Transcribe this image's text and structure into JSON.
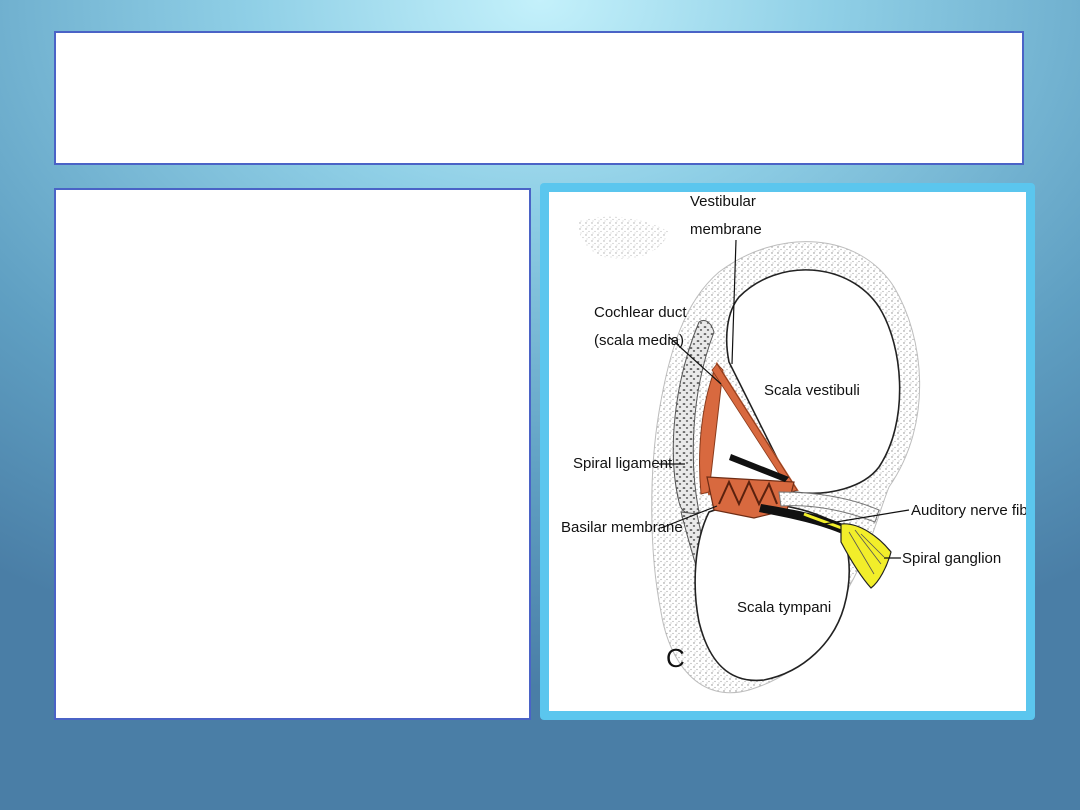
{
  "slide": {
    "title": "",
    "body": ""
  },
  "figure": {
    "labels": {
      "vestibular_membrane_1": "Vestibular",
      "vestibular_membrane_2": "membrane",
      "cochlear_duct_1": "Cochlear duct",
      "cochlear_duct_2": "(scala media)",
      "scala_vestibuli": "Scala vestibuli",
      "spiral_ligament": "Spiral ligament",
      "basilar_membrane": "Basilar membrane",
      "auditory_nerve_fibers": "Auditory nerve fibers",
      "spiral_ganglion": "Spiral ganglion",
      "scala_tympani": "Scala tympani",
      "panel_letter": "C"
    },
    "colors": {
      "duct": "#d8693f",
      "ganglion": "#f2ee2a",
      "bone_stipple": "#9a9a9a",
      "frame": "#5bc6ee"
    }
  }
}
